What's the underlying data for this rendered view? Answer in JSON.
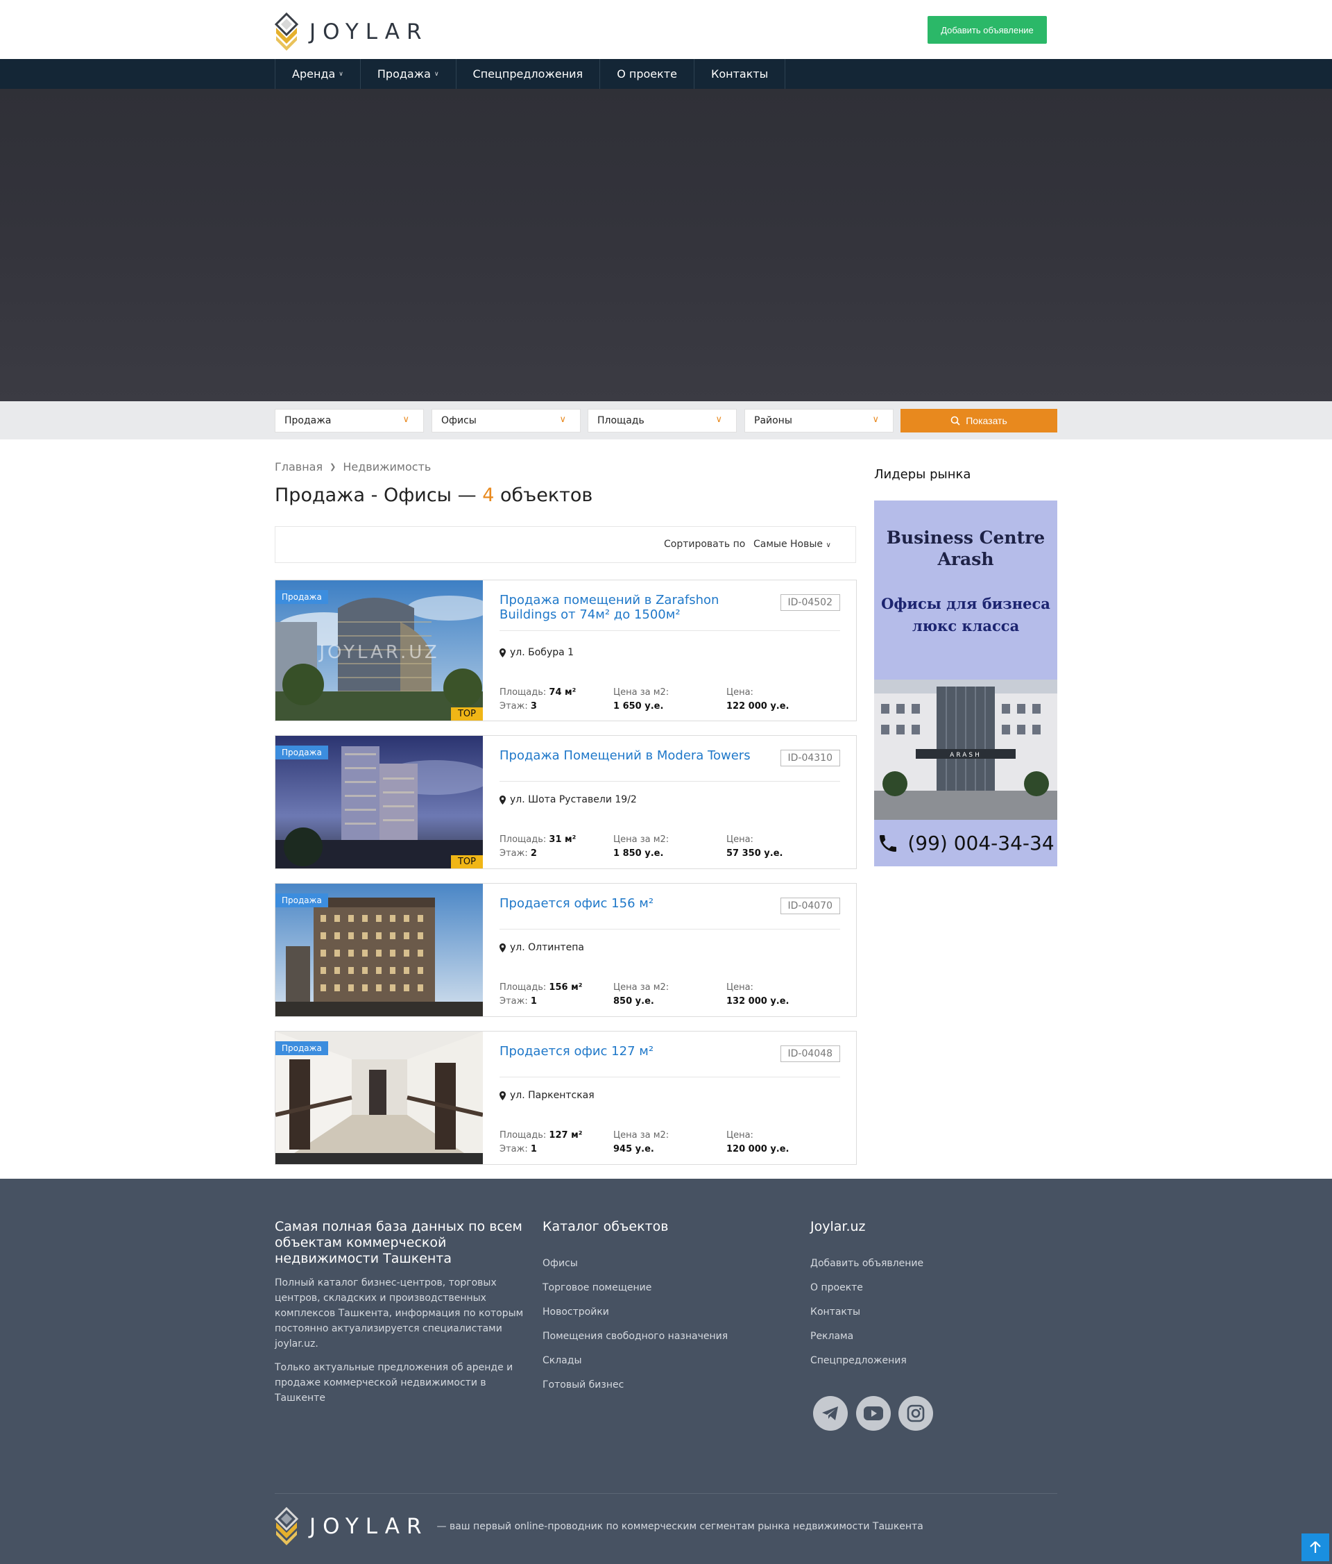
{
  "header": {
    "logo_text": "JOYLAR",
    "add_button": "Добавить объявление"
  },
  "nav": {
    "items": [
      {
        "label": "Аренда",
        "has_dropdown": true
      },
      {
        "label": "Продажа",
        "has_dropdown": true
      },
      {
        "label": "Спецпредложения",
        "has_dropdown": false
      },
      {
        "label": "О проекте",
        "has_dropdown": false
      },
      {
        "label": "Контакты",
        "has_dropdown": false
      }
    ]
  },
  "filter": {
    "deal": "Продажа",
    "type": "Офисы",
    "area": "Площадь",
    "district": "Районы",
    "show_button": "Показать"
  },
  "breadcrumb": {
    "home": "Главная",
    "current": "Недвижимость"
  },
  "page_title": {
    "prefix": "Продажа - Офисы —",
    "count": "4",
    "suffix": "объектов"
  },
  "sort": {
    "label": "Сортировать по",
    "value": "Самые Новые"
  },
  "listings": [
    {
      "badge": "Продажа",
      "top": "TOP",
      "title": "Продажа помещений в Zarafshon Buildings от 74м² до 1500м²",
      "id": "ID-04502",
      "address": "ул. Бобура 1",
      "area_label": "Площадь:",
      "area": "74 м²",
      "floor_label": "Этаж:",
      "floor": "3",
      "ppm_label": "Цена за м2:",
      "ppm": "1 650 у.е.",
      "price_label": "Цена:",
      "price": "122 000 у.е."
    },
    {
      "badge": "Продажа",
      "top": "TOP",
      "title": "Продажа Помещений в Modera Towers",
      "id": "ID-04310",
      "address": "ул. Шота Руставели 19/2",
      "area_label": "Площадь:",
      "area": "31 м²",
      "floor_label": "Этаж:",
      "floor": "2",
      "ppm_label": "Цена за м2:",
      "ppm": "1 850 у.е.",
      "price_label": "Цена:",
      "price": "57 350 у.е."
    },
    {
      "badge": "Продажа",
      "top": "",
      "title": "Продается офис 156 м²",
      "id": "ID-04070",
      "address": "ул. Олтинтепа",
      "area_label": "Площадь:",
      "area": "156 м²",
      "floor_label": "Этаж:",
      "floor": "1",
      "ppm_label": "Цена за м2:",
      "ppm": "850 у.е.",
      "price_label": "Цена:",
      "price": "132 000 у.е."
    },
    {
      "badge": "Продажа",
      "top": "",
      "title": "Продается офис 127 м²",
      "id": "ID-04048",
      "address": "ул. Паркентская",
      "area_label": "Площадь:",
      "area": "127 м²",
      "floor_label": "Этаж:",
      "floor": "1",
      "ppm_label": "Цена за м2:",
      "ppm": "945 у.е.",
      "price_label": "Цена:",
      "price": "120 000 у.е."
    }
  ],
  "photo_watermark": "JOYLAR.UZ",
  "sidebar": {
    "title": "Лидеры рынка",
    "ad": {
      "line1": "Business Centre",
      "line2": "Arash",
      "line3": "Офисы для бизнеса",
      "line4": "люкс класса",
      "building_sign": "ARASH",
      "phone": "(99) 004-34-34"
    }
  },
  "footer": {
    "col1": {
      "title": "Самая полная база данных по всем объектам коммерческой недвижимости Ташкента",
      "p1": "Полный каталог бизнес-центров, торговых центров, складских и производственных комплексов Ташкента, информация по которым постоянно актуализируется специалистами joylar.uz.",
      "p2": "Только актуальные предложения об аренде и продаже коммерческой недвижимости в Ташкенте"
    },
    "col2": {
      "title": "Каталог объектов",
      "links": [
        "Офисы",
        "Торговое помещение",
        "Новостройки",
        "Помещения свободного назначения",
        "Склады",
        "Готовый бизнес"
      ]
    },
    "col3": {
      "title": "Joylar.uz",
      "links": [
        "Добавить объявление",
        "О проекте",
        "Контакты",
        "Реклама",
        "Спецпредложения"
      ]
    },
    "social": [
      "telegram-icon",
      "youtube-icon",
      "instagram-icon"
    ],
    "logo_text": "JOYLAR",
    "tagline": "— ваш первый online-проводник по коммерческим сегментам рынка недвижимости Ташкента"
  },
  "colors": {
    "nav_bg": "#142636",
    "accent_orange": "#e8891e",
    "accent_green": "#2bb868",
    "link_blue": "#1f78c9",
    "badge_blue": "#3c8dde",
    "top_yellow": "#f0b616",
    "footer_bg": "#475262"
  }
}
